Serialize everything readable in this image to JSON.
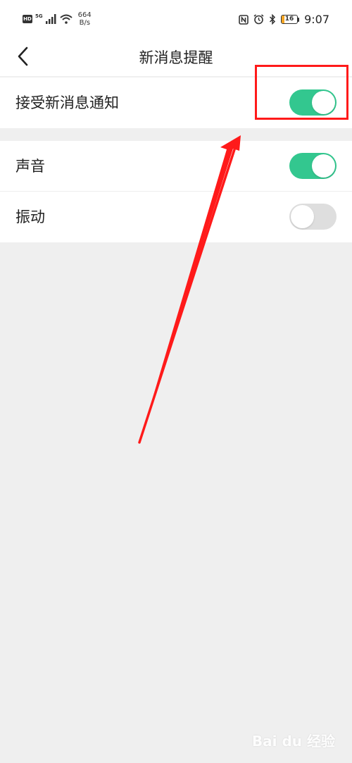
{
  "status_bar": {
    "hd_badge": "HD",
    "signal_label": "5G",
    "net_speed_value": "664",
    "net_speed_unit": "B/s",
    "battery_level": "16",
    "time": "9:07"
  },
  "header": {
    "title": "新消息提醒"
  },
  "settings": {
    "receive_notifications": {
      "label": "接受新消息通知",
      "enabled": true
    },
    "sound": {
      "label": "声音",
      "enabled": true
    },
    "vibration": {
      "label": "振动",
      "enabled": false
    }
  },
  "colors": {
    "toggle_on": "#33c78f",
    "toggle_off": "#dedede",
    "annotation": "#ff1a1a",
    "page_background": "#efefef"
  },
  "watermark": {
    "text": "Bai du 经验"
  }
}
